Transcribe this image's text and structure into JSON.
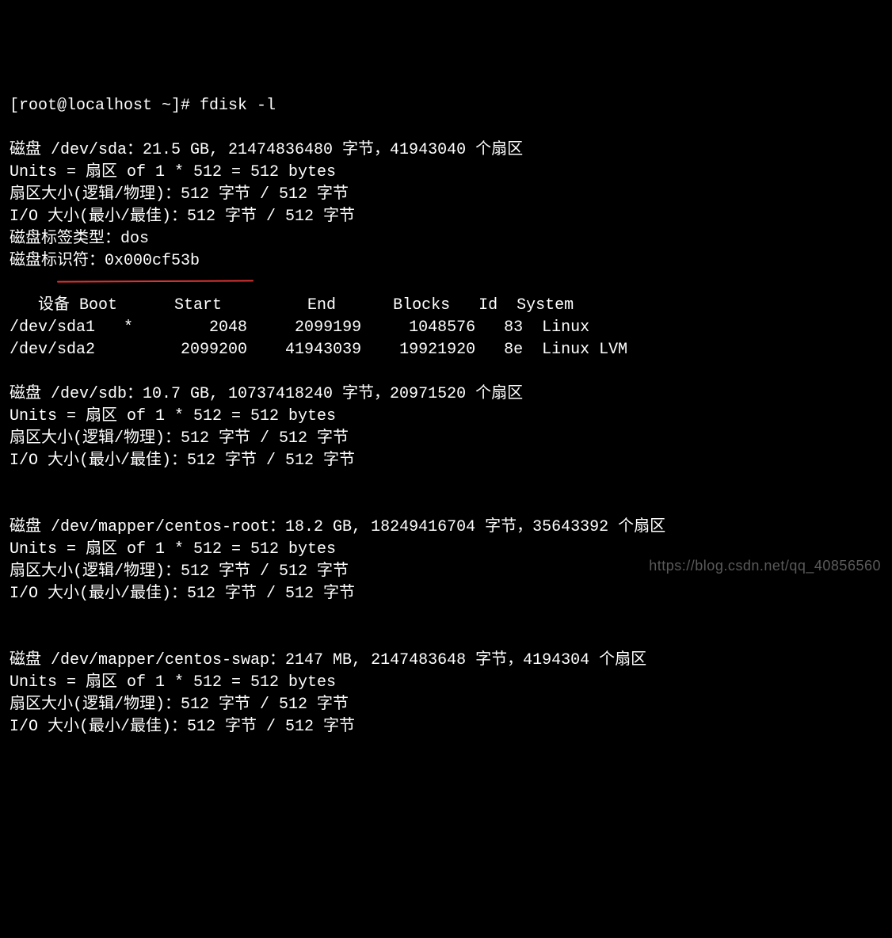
{
  "prompt": "[root@localhost ~]# ",
  "command": "fdisk -l",
  "sda": {
    "header": "磁盘 /dev/sda：21.5 GB, 21474836480 字节，41943040 个扇区",
    "units": "Units = 扇区 of 1 * 512 = 512 bytes",
    "sector": "扇区大小(逻辑/物理)：512 字节 / 512 字节",
    "io": "I/O 大小(最小/最佳)：512 字节 / 512 字节",
    "labeltype": "磁盘标签类型：dos",
    "identifier": "磁盘标识符：0x000cf53b",
    "table_header": "   设备 Boot      Start         End      Blocks   Id  System",
    "row1": "/dev/sda1   *        2048     2099199     1048576   83  Linux",
    "row2": "/dev/sda2         2099200    41943039    19921920   8e  Linux LVM"
  },
  "sdb": {
    "header": "磁盘 /dev/sdb：10.7 GB, 10737418240 字节，20971520 个扇区",
    "units": "Units = 扇区 of 1 * 512 = 512 bytes",
    "sector": "扇区大小(逻辑/物理)：512 字节 / 512 字节",
    "io": "I/O 大小(最小/最佳)：512 字节 / 512 字节"
  },
  "centos_root": {
    "header": "磁盘 /dev/mapper/centos-root：18.2 GB, 18249416704 字节，35643392 个扇区",
    "units": "Units = 扇区 of 1 * 512 = 512 bytes",
    "sector": "扇区大小(逻辑/物理)：512 字节 / 512 字节",
    "io": "I/O 大小(最小/最佳)：512 字节 / 512 字节"
  },
  "centos_swap": {
    "header": "磁盘 /dev/mapper/centos-swap：2147 MB, 2147483648 字节，4194304 个扇区",
    "units": "Units = 扇区 of 1 * 512 = 512 bytes",
    "sector": "扇区大小(逻辑/物理)：512 字节 / 512 字节",
    "io": "I/O 大小(最小/最佳)：512 字节 / 512 字节"
  },
  "watermark": "https://blog.csdn.net/qq_40856560"
}
